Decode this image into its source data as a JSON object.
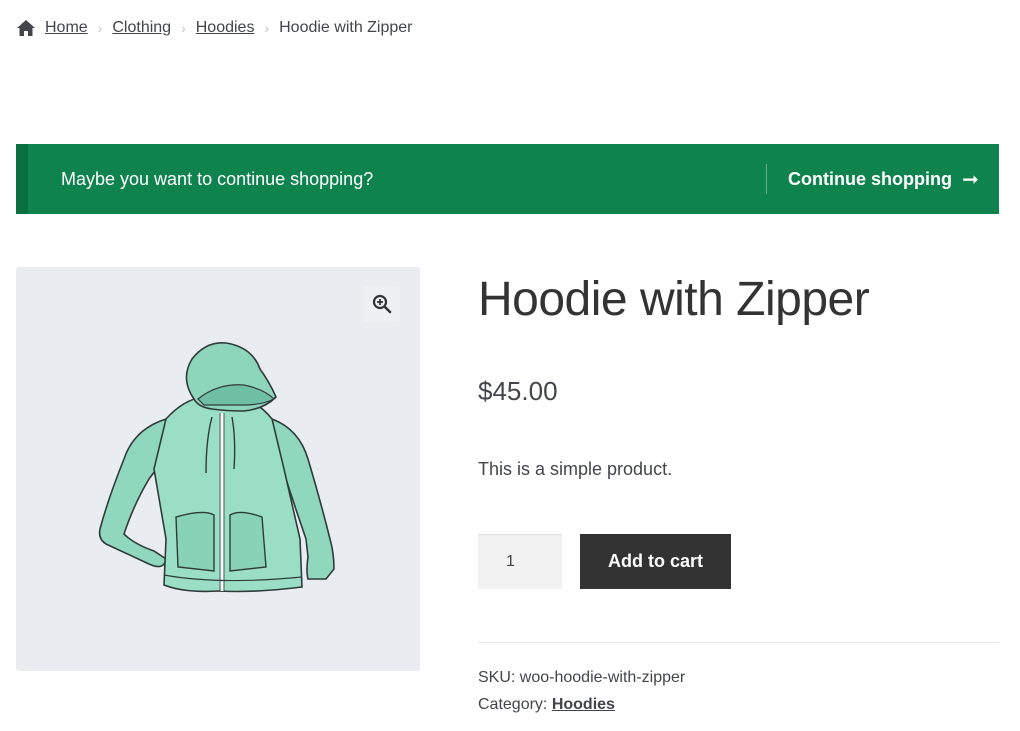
{
  "breadcrumb": {
    "icon": "home-icon",
    "items": [
      "Home",
      "Clothing",
      "Hoodies"
    ],
    "current": "Hoodie with Zipper",
    "separator": "›"
  },
  "notice": {
    "message": "Maybe you want to continue shopping?",
    "action_label": "Continue shopping",
    "action_icon": "arrow-right-icon",
    "arrow": "➞",
    "color": "#0f834d"
  },
  "gallery": {
    "zoom_icon": "zoom-in-icon",
    "image": "hoodie-with-zipper-image"
  },
  "product": {
    "title": "Hoodie with Zipper",
    "price": "$45.00",
    "description": "This is a simple product.",
    "quantity": "1",
    "add_to_cart_label": "Add to cart"
  },
  "meta": {
    "sku_label": "SKU:",
    "sku_value": "woo-hoodie-with-zipper",
    "category_label": "Category:",
    "category_value": "Hoodies"
  }
}
